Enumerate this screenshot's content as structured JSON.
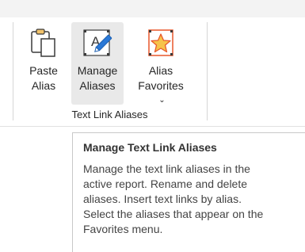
{
  "ribbon": {
    "group_label": "Text Link Aliases",
    "buttons": [
      {
        "line1": "Paste",
        "line2": "Alias",
        "icon": "paste-icon"
      },
      {
        "line1": "Manage",
        "line2": "Aliases",
        "icon": "manage-aliases-icon"
      },
      {
        "line1": "Alias",
        "line2": "Favorites",
        "icon": "star-favorites-icon",
        "dropdown_glyph": "⌄"
      }
    ]
  },
  "tooltip": {
    "title": "Manage Text Link Aliases",
    "lines": [
      "Manage the text link aliases in the",
      "active report. Rename and delete",
      "aliases. Insert text links by alias.",
      "Select the aliases that appear on the",
      "Favorites menu."
    ]
  },
  "colors": {
    "star_fill": "#f6c34a",
    "star_accent": "#e8572a",
    "pen_blue": "#2a78d6",
    "hover_bg": "#e9e9e9"
  }
}
